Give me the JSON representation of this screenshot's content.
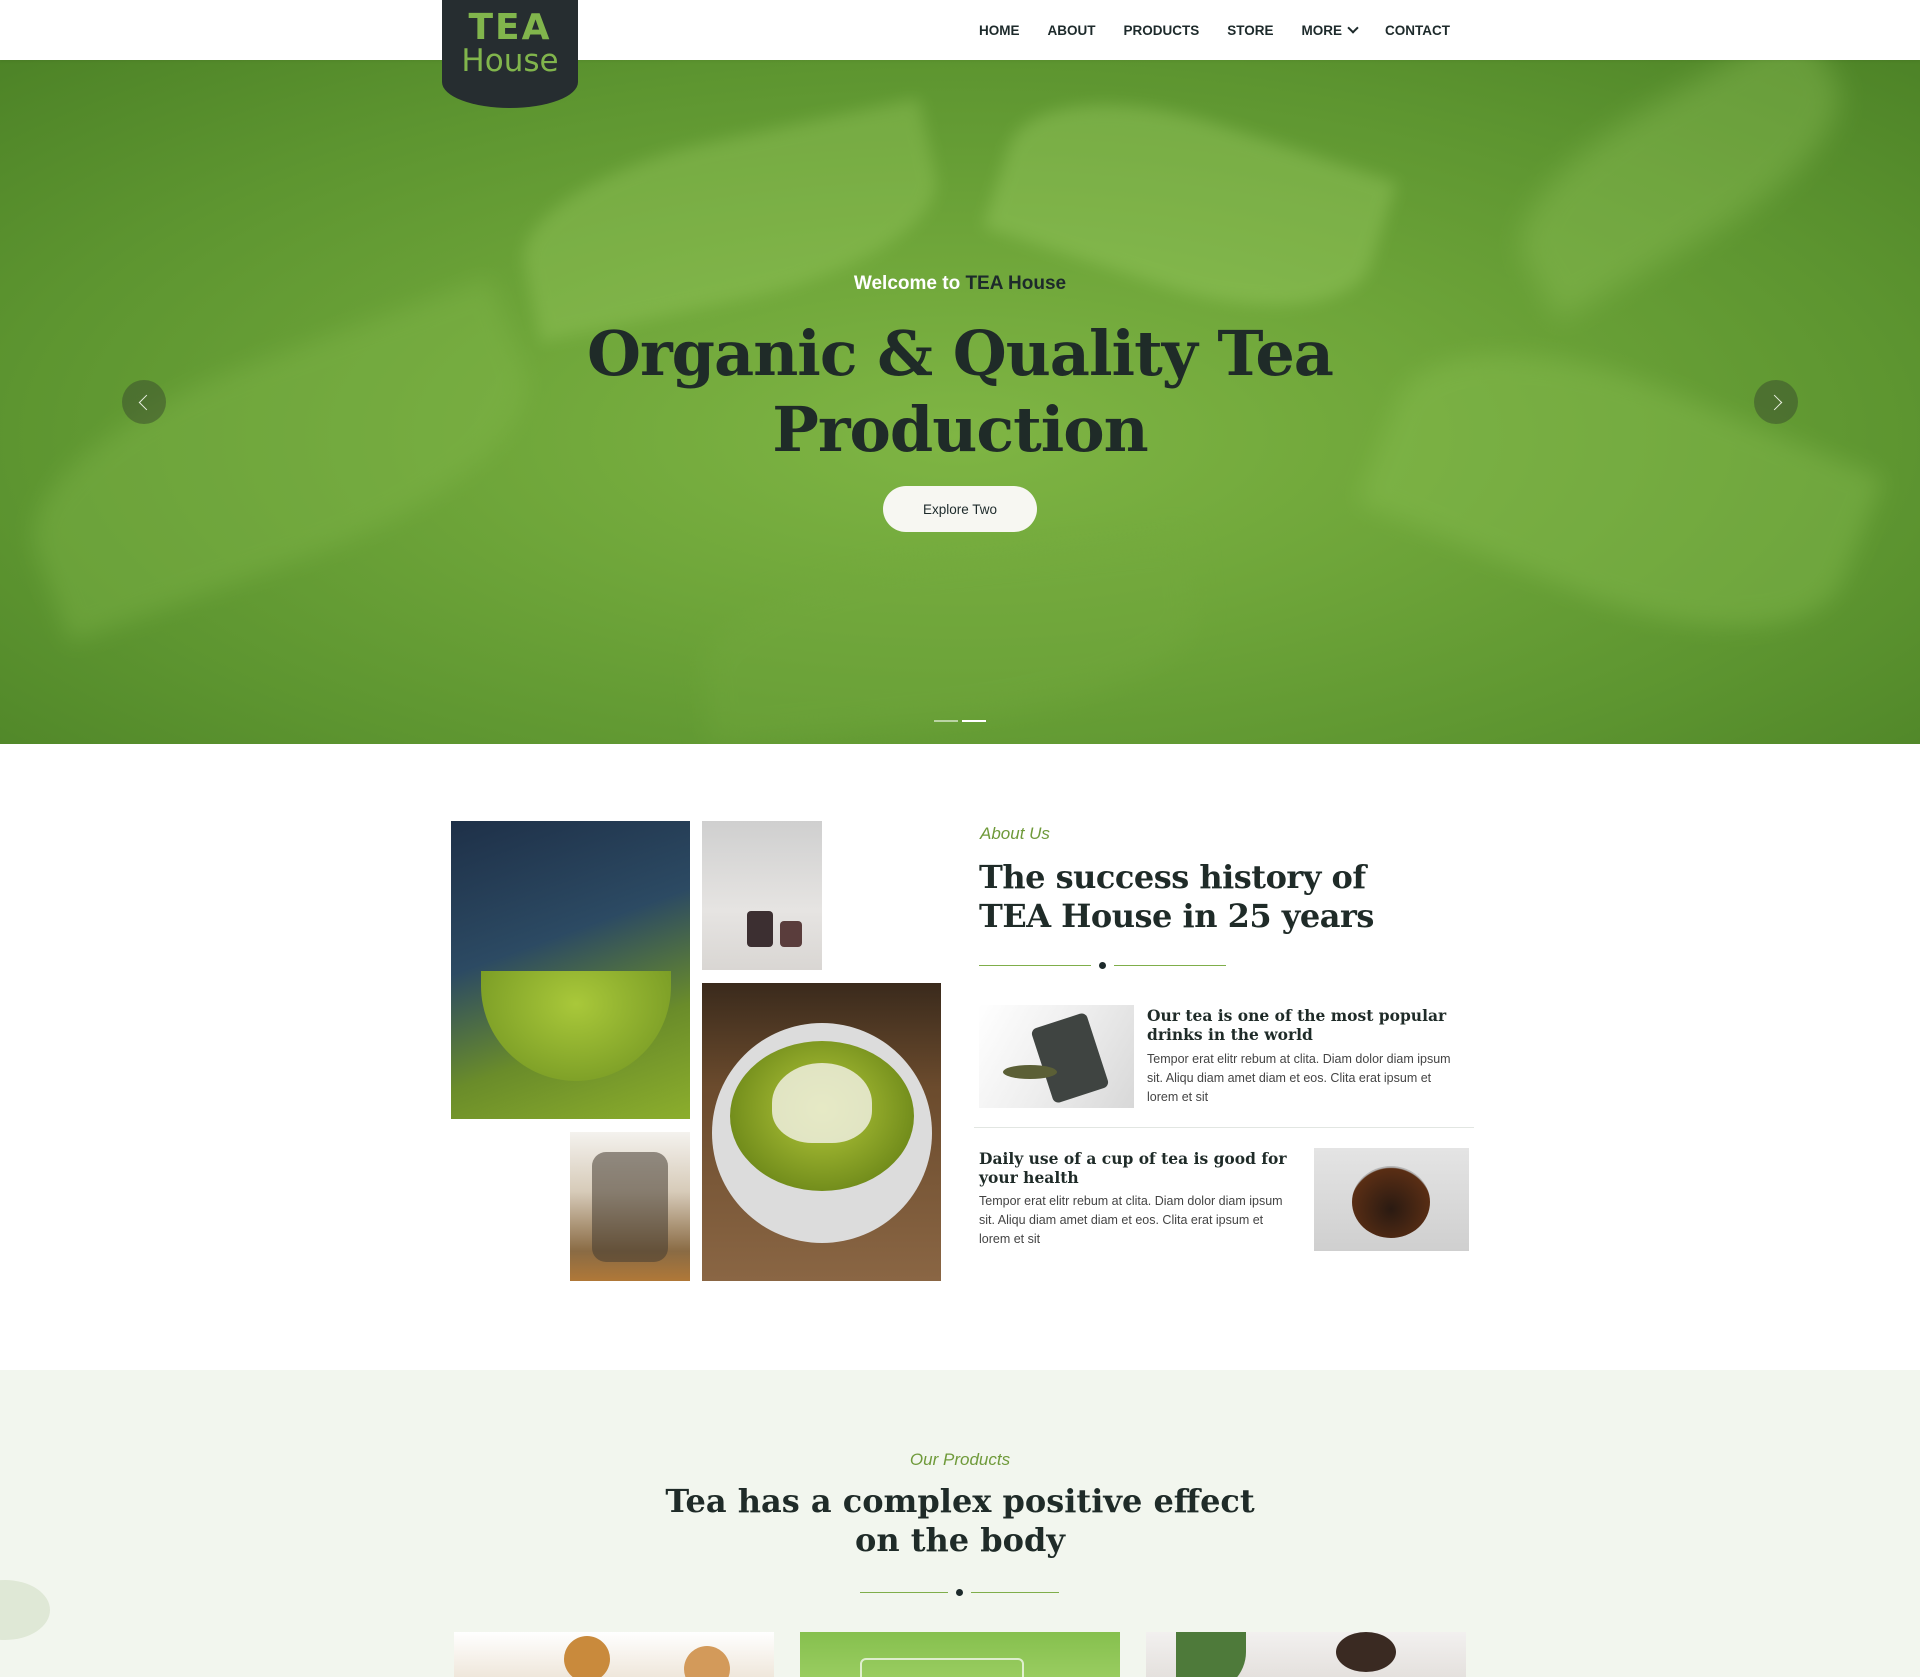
{
  "logo": {
    "line1": "TEA",
    "line2": "House"
  },
  "nav": {
    "items": [
      {
        "label": "HOME"
      },
      {
        "label": "ABOUT"
      },
      {
        "label": "PRODUCTS"
      },
      {
        "label": "STORE"
      },
      {
        "label": "MORE",
        "has_dropdown": true
      },
      {
        "label": "CONTACT"
      }
    ]
  },
  "hero": {
    "welcome_prefix": "Welcome to",
    "welcome_brand": "TEA House",
    "title_line1": "Organic & Quality Tea",
    "title_line2": "Production",
    "button_label": "Explore Two",
    "slide_count": 2,
    "active_slide": 2
  },
  "about": {
    "label": "About Us",
    "title": "The success history of TEA House in 25 years",
    "features": [
      {
        "title": "Our tea is one of the most popular drinks in the world",
        "text": "Tempor erat elitr rebum at clita. Diam dolor diam ipsum sit. Aliqu diam amet diam et eos. Clita erat ipsum et lorem et sit"
      },
      {
        "title": "Daily use of a cup of tea is good for your health",
        "text": "Tempor erat elitr rebum at clita. Diam dolor diam ipsum sit. Aliqu diam amet diam et eos. Clita erat ipsum et lorem et sit"
      }
    ]
  },
  "products": {
    "label": "Our Products",
    "title": "Tea has a complex positive effect on the body"
  },
  "colors": {
    "accent_green": "#81b54c",
    "dark": "#262d30",
    "products_bg": "#f2f6ee"
  }
}
